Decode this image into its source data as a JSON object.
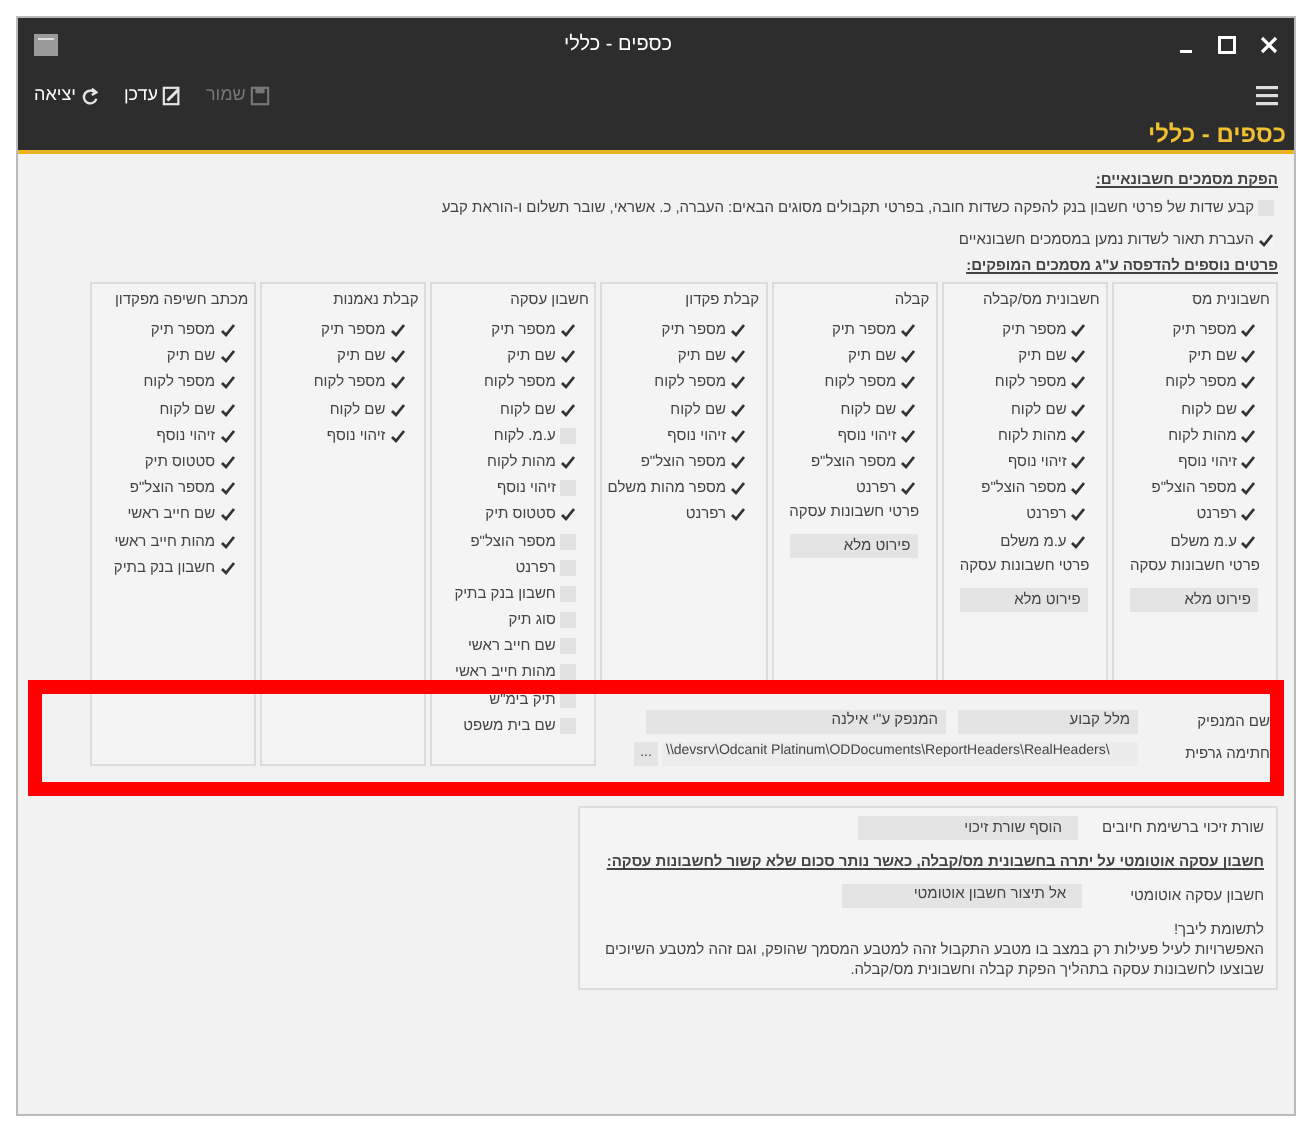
{
  "window": {
    "title": "כספים - כללי"
  },
  "toolbar": [
    {
      "label": "שמור",
      "kind": "save",
      "disabled": true
    },
    {
      "label": "עדכן",
      "kind": "edit",
      "disabled": false
    },
    {
      "label": "יציאה",
      "kind": "exit",
      "disabled": false
    }
  ],
  "page_title": "כספים - כללי",
  "documents_section": {
    "heading": "הפקת מסמכים חשבונאיים:",
    "options": [
      {
        "label": "קבע שדות של פרטי חשבון בנק להפקה כשדות חובה, בפרטי תקבולים מסוגים הבאים: העברה, כ. אשראי, שובר תשלום ו-הוראת קבע",
        "checked": false
      },
      {
        "label": "העברת תאור לשדות נמען במסמכים חשבונאיים",
        "checked": true
      }
    ]
  },
  "print_section": {
    "heading": "פרטים נוספים להדפסה ע\"ג מסמכים המופקים:",
    "columns": [
      {
        "title": "חשבונית מס",
        "items": [
          {
            "label": "מספר תיק",
            "checked": true
          },
          {
            "label": "שם תיק",
            "checked": true
          },
          {
            "label": "מספר לקוח",
            "checked": true
          },
          {
            "label": "שם לקוח",
            "checked": true
          },
          {
            "label": "מהות לקוח",
            "checked": true
          },
          {
            "label": "זיהוי נוסף",
            "checked": true
          },
          {
            "label": "מספר הוצל\"פ",
            "checked": true
          },
          {
            "label": "רפרנט",
            "checked": true
          },
          {
            "label": "ע.מ משלם",
            "checked": true
          }
        ],
        "extra_label": "פרטי חשבונות עסקה",
        "button": "פירוט מלא"
      },
      {
        "title": "חשבונית מס/קבלה",
        "items": [
          {
            "label": "מספר תיק",
            "checked": true
          },
          {
            "label": "שם תיק",
            "checked": true
          },
          {
            "label": "מספר לקוח",
            "checked": true
          },
          {
            "label": "שם לקוח",
            "checked": true
          },
          {
            "label": "מהות לקוח",
            "checked": true
          },
          {
            "label": "זיהוי נוסף",
            "checked": true
          },
          {
            "label": "מספר הוצל\"פ",
            "checked": true
          },
          {
            "label": "רפרנט",
            "checked": true
          },
          {
            "label": "ע.מ משלם",
            "checked": true
          }
        ],
        "extra_label": "פרטי חשבונות עסקה",
        "button": "פירוט מלא"
      },
      {
        "title": "קבלה",
        "items": [
          {
            "label": "מספר תיק",
            "checked": true
          },
          {
            "label": "שם תיק",
            "checked": true
          },
          {
            "label": "מספר לקוח",
            "checked": true
          },
          {
            "label": "שם לקוח",
            "checked": true
          },
          {
            "label": "זיהוי נוסף",
            "checked": true
          },
          {
            "label": "מספר הוצל\"פ",
            "checked": true
          },
          {
            "label": "רפרנט",
            "checked": true
          }
        ],
        "extra_label": "פרטי חשבונות עסקה",
        "button": "פירוט מלא"
      },
      {
        "title": "קבלת פקדון",
        "items": [
          {
            "label": "מספר תיק",
            "checked": true
          },
          {
            "label": "שם תיק",
            "checked": true
          },
          {
            "label": "מספר לקוח",
            "checked": true
          },
          {
            "label": "שם לקוח",
            "checked": true
          },
          {
            "label": "זיהוי נוסף",
            "checked": true
          },
          {
            "label": "מספר הוצל\"פ",
            "checked": true
          },
          {
            "label": "מספר מהות משלם",
            "checked": true
          },
          {
            "label": "רפרנט",
            "checked": true
          }
        ]
      },
      {
        "title": "חשבון עסקה",
        "items": [
          {
            "label": "מספר תיק",
            "checked": true
          },
          {
            "label": "שם תיק",
            "checked": true
          },
          {
            "label": "מספר לקוח",
            "checked": true
          },
          {
            "label": "שם לקוח",
            "checked": true
          },
          {
            "label": "ע.מ. לקוח",
            "checked": false
          },
          {
            "label": "מהות לקוח",
            "checked": true
          },
          {
            "label": "זיהוי נוסף",
            "checked": false
          },
          {
            "label": "סטטוס תיק",
            "checked": true
          },
          {
            "label": "מספר הוצל\"פ",
            "checked": false
          },
          {
            "label": "רפרנט",
            "checked": false
          },
          {
            "label": "חשבון בנק בתיק",
            "checked": false
          },
          {
            "label": "סוג תיק",
            "checked": false
          },
          {
            "label": "שם חייב ראשי",
            "checked": false
          },
          {
            "label": "מהות חייב ראשי",
            "checked": false
          },
          {
            "label": "תיק בימ\"ש",
            "checked": false
          },
          {
            "label": "שם בית משפט",
            "checked": false
          }
        ]
      },
      {
        "title": "קבלת נאמנות",
        "items": [
          {
            "label": "מספר תיק",
            "checked": true
          },
          {
            "label": "שם תיק",
            "checked": true
          },
          {
            "label": "מספר לקוח",
            "checked": true
          },
          {
            "label": "שם לקוח",
            "checked": true
          },
          {
            "label": "זיהוי נוסף",
            "checked": true
          }
        ]
      },
      {
        "title": "מכתב חשיפה מפקדון",
        "items": [
          {
            "label": "מספר תיק",
            "checked": true
          },
          {
            "label": "שם תיק",
            "checked": true
          },
          {
            "label": "מספר לקוח",
            "checked": true
          },
          {
            "label": "שם לקוח",
            "checked": true
          },
          {
            "label": "זיהוי נוסף",
            "checked": true
          },
          {
            "label": "סטטוס תיק",
            "checked": true
          },
          {
            "label": "מספר הוצל\"פ",
            "checked": true
          },
          {
            "label": "שם חייב ראשי",
            "checked": true
          },
          {
            "label": "מהות חייב ראשי",
            "checked": true
          },
          {
            "label": "חשבון בנק בתיק",
            "checked": true
          }
        ]
      }
    ]
  },
  "issuer": {
    "label": "שם המנפיק",
    "type_value": "מלל קבוע",
    "value": "המנפק ע\"י אילנה"
  },
  "signature": {
    "label": "חתימה גרפית",
    "path": "\\\\devsrv\\Odcanit Platinum\\ODDocuments\\ReportHeaders\\RealHeaders\\",
    "browse": "..."
  },
  "credit_line": {
    "label": "שורת זיכוי ברשימת חיובים",
    "button": "הוסף שורת זיכוי"
  },
  "auto_account": {
    "heading": "חשבון עסקה אוטומטי על יתרה בחשבונית מס/קבלה, כאשר נותר סכום שלא קשור לחשבונות עסקה:",
    "label": "חשבון עסקה אוטומטי",
    "value": "אל תיצור חשבון אוטומטי"
  },
  "note": {
    "title": "לתשומת ליבך!",
    "text": "האפשרויות לעיל פעילות רק במצב בו מטבע התקבול זהה למטבע המסמך שהופק, וגם זהה למטבע השיוכים שבוצעו לחשבונות עסקה בתהליך הפקת קבלה וחשבונית מס/קבלה."
  }
}
